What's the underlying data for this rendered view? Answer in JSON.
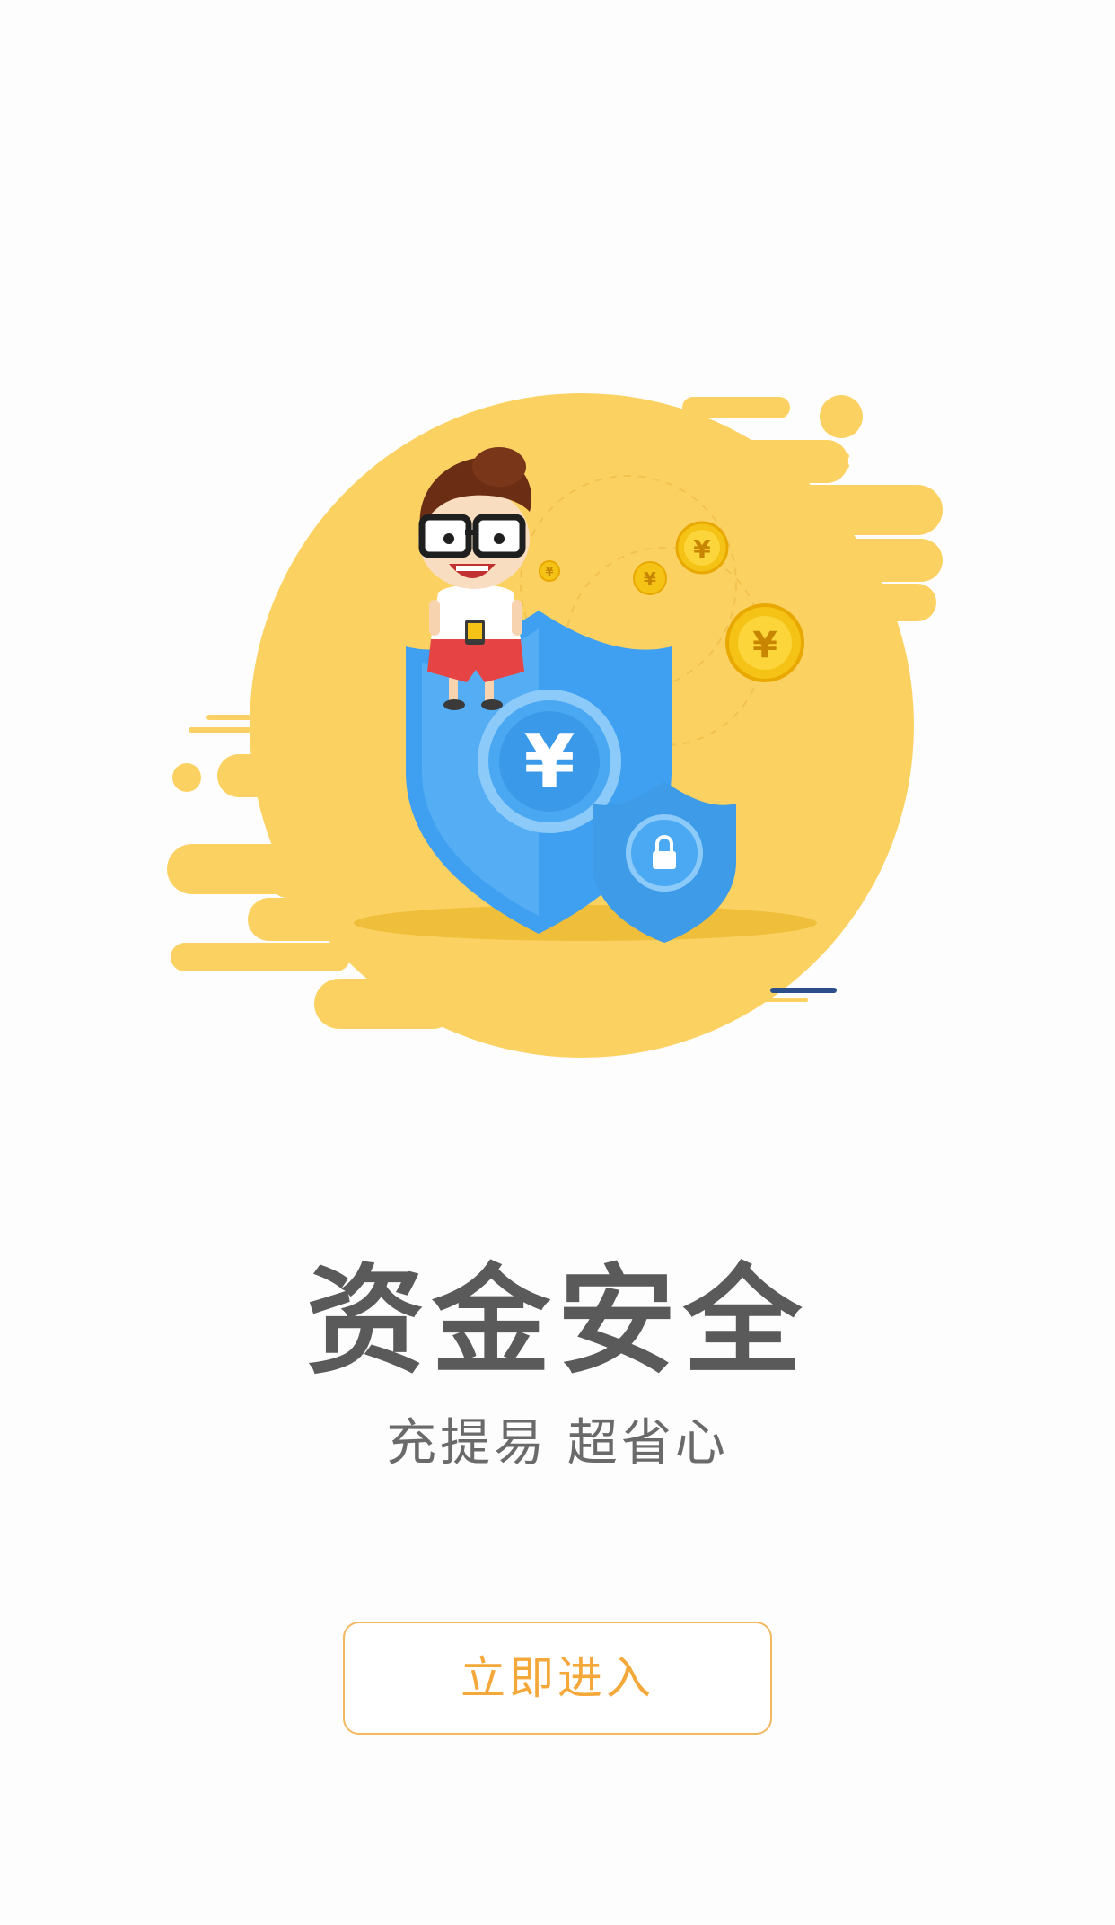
{
  "title": "资金安全",
  "subtitle": "充提易 超省心",
  "enter_button": {
    "label": "立即进入"
  },
  "illustration": {
    "currency_symbol": "¥",
    "icons": [
      "shield-icon",
      "lock-icon",
      "coin-icon",
      "cartoon-boy"
    ]
  },
  "colors": {
    "yellow": "#fbd262",
    "shield_blue": "#42a5f0",
    "button_text": "#f4a83a",
    "button_border": "#f2b860",
    "title_text": "#5a5a5a"
  }
}
